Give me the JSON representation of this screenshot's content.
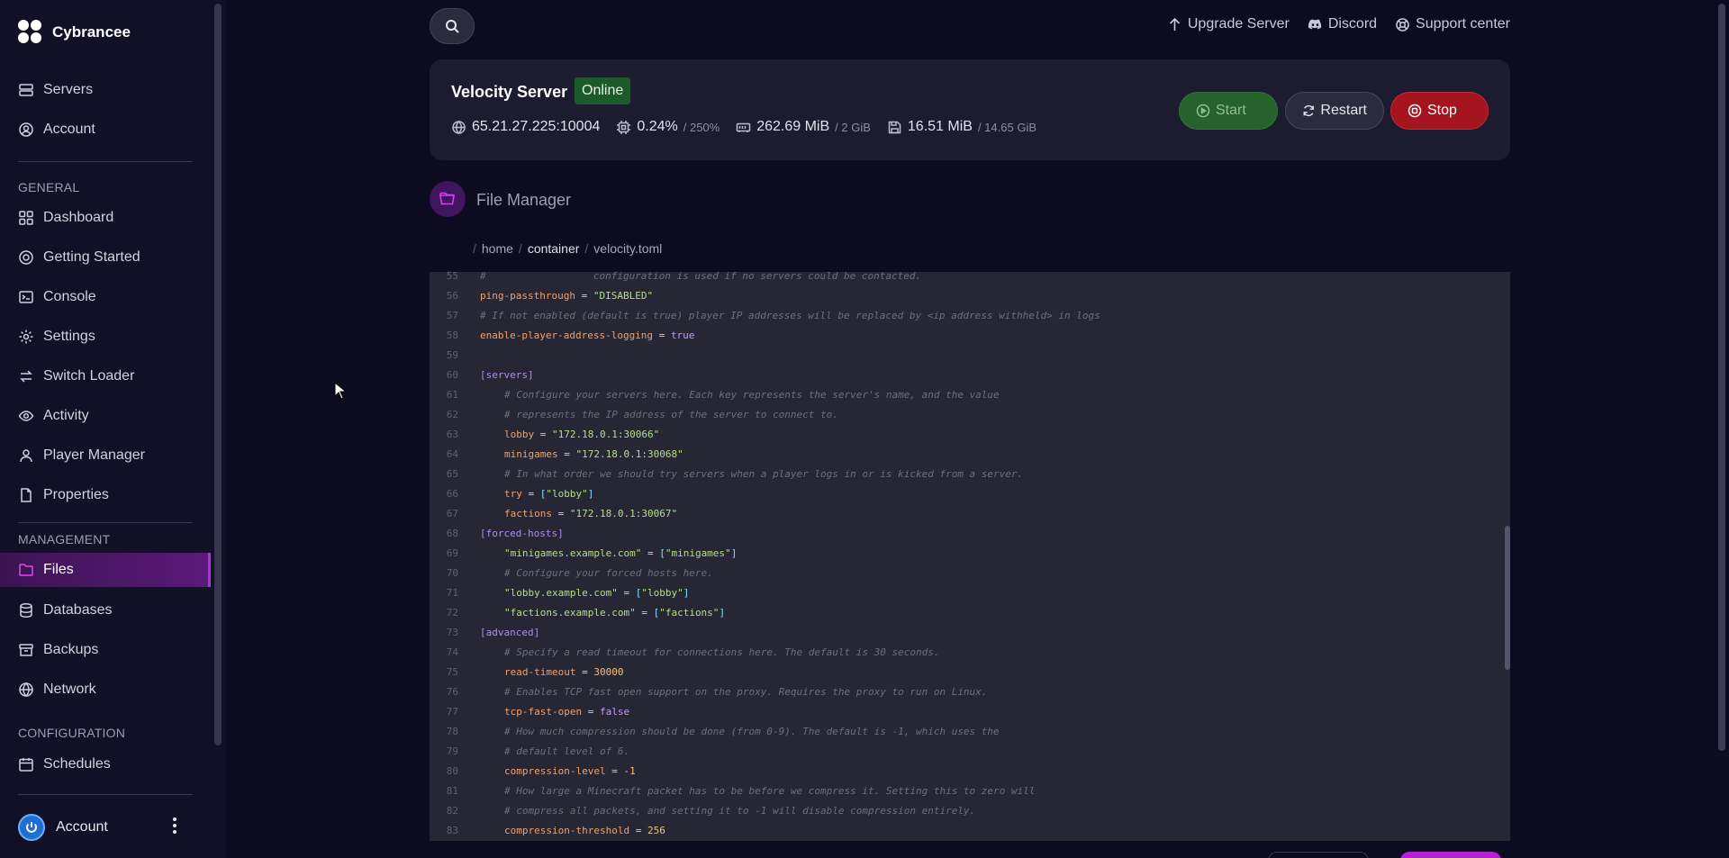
{
  "brand": {
    "name": "Cybrancee"
  },
  "sidebar": {
    "top_items": [
      {
        "label": "Servers"
      },
      {
        "label": "Account"
      }
    ],
    "sections": [
      {
        "title": "GENERAL"
      },
      {
        "title": "MANAGEMENT"
      },
      {
        "title": "CONFIGURATION"
      }
    ],
    "general": [
      {
        "label": "Dashboard"
      },
      {
        "label": "Getting Started"
      },
      {
        "label": "Console"
      },
      {
        "label": "Settings"
      },
      {
        "label": "Switch Loader"
      },
      {
        "label": "Activity"
      },
      {
        "label": "Player Manager"
      },
      {
        "label": "Properties"
      }
    ],
    "management": [
      {
        "label": "Files"
      },
      {
        "label": "Databases"
      },
      {
        "label": "Backups"
      },
      {
        "label": "Network"
      }
    ],
    "configuration": [
      {
        "label": "Schedules"
      }
    ],
    "account_label": "Account"
  },
  "topbar": {
    "links": [
      {
        "label": "Upgrade Server",
        "icon": "arrow-up-icon"
      },
      {
        "label": "Discord",
        "icon": "discord-icon"
      },
      {
        "label": "Support center",
        "icon": "lifebuoy-icon"
      }
    ]
  },
  "server": {
    "name": "Velocity Server",
    "status": "Online",
    "address": "65.21.27.225:10004",
    "cpu": "0.24%",
    "cpu_limit": "/ 250%",
    "memory": "262.69 MiB",
    "memory_limit": "/ 2 GiB",
    "disk": "16.51 MiB",
    "disk_limit": "/ 14.65 GiB",
    "buttons": {
      "start": "Start",
      "restart": "Restart",
      "stop": "Stop"
    },
    "colors": {
      "online": "#1d5a2a",
      "start": "#27612c",
      "stop": "#a4151f"
    }
  },
  "file_manager": {
    "title": "File Manager",
    "breadcrumb": {
      "root": "home",
      "folder": "container",
      "file": "velocity.toml"
    }
  },
  "editor": {
    "lines": [
      {
        "n": "55",
        "indent": 0,
        "tokens": [
          [
            "c-comment",
            "#                  configuration is used if no servers could be contacted."
          ]
        ]
      },
      {
        "n": "56",
        "indent": 0,
        "tokens": [
          [
            "c-key",
            "ping-passthrough"
          ],
          [
            "",
            " = "
          ],
          [
            "c-str",
            "\"DISABLED\""
          ]
        ]
      },
      {
        "n": "57",
        "indent": 0,
        "tokens": [
          [
            "c-comment",
            "# If not enabled (default is true) player IP addresses will be replaced by <ip address withheld> in logs"
          ]
        ]
      },
      {
        "n": "58",
        "indent": 0,
        "tokens": [
          [
            "c-key",
            "enable-player-address-logging"
          ],
          [
            "",
            " = "
          ],
          [
            "c-bool",
            "true"
          ]
        ]
      },
      {
        "n": "59",
        "indent": 0,
        "tokens": []
      },
      {
        "n": "60",
        "indent": 0,
        "tokens": [
          [
            "c-sec",
            "[servers]"
          ]
        ]
      },
      {
        "n": "61",
        "indent": 1,
        "tokens": [
          [
            "c-comment",
            "# Configure your servers here. Each key represents the server's name, and the value"
          ]
        ]
      },
      {
        "n": "62",
        "indent": 1,
        "tokens": [
          [
            "c-comment",
            "# represents the IP address of the server to connect to."
          ]
        ]
      },
      {
        "n": "63",
        "indent": 1,
        "tokens": [
          [
            "c-key",
            "lobby"
          ],
          [
            "",
            " = "
          ],
          [
            "c-str",
            "\"172.18.0.1:30066\""
          ]
        ]
      },
      {
        "n": "64",
        "indent": 1,
        "tokens": [
          [
            "c-key",
            "minigames"
          ],
          [
            "",
            " = "
          ],
          [
            "c-str",
            "\"172.18.0.1:30068\""
          ]
        ]
      },
      {
        "n": "65",
        "indent": 1,
        "tokens": [
          [
            "c-comment",
            "# In what order we should try servers when a player logs in or is kicked from a server."
          ]
        ]
      },
      {
        "n": "66",
        "indent": 1,
        "tokens": [
          [
            "c-key",
            "try"
          ],
          [
            "",
            " = "
          ],
          [
            "c-punct",
            "["
          ],
          [
            "c-str",
            "\"lobby\""
          ],
          [
            "c-punct",
            "]"
          ]
        ]
      },
      {
        "n": "67",
        "indent": 1,
        "tokens": [
          [
            "c-key",
            "factions"
          ],
          [
            "",
            " = "
          ],
          [
            "c-str",
            "\"172.18.0.1:30067\""
          ]
        ]
      },
      {
        "n": "68",
        "indent": 0,
        "tokens": [
          [
            "c-sec",
            "[forced-hosts]"
          ]
        ]
      },
      {
        "n": "69",
        "indent": 1,
        "tokens": [
          [
            "c-str",
            "\"minigames.example.com\""
          ],
          [
            "",
            " = "
          ],
          [
            "c-punct",
            "["
          ],
          [
            "c-str",
            "\"minigames\""
          ],
          [
            "c-punct",
            "]"
          ]
        ]
      },
      {
        "n": "70",
        "indent": 1,
        "tokens": [
          [
            "c-comment",
            "# Configure your forced hosts here."
          ]
        ]
      },
      {
        "n": "71",
        "indent": 1,
        "tokens": [
          [
            "c-str",
            "\"lobby.example.com\""
          ],
          [
            "",
            " = "
          ],
          [
            "c-punct",
            "["
          ],
          [
            "c-str",
            "\"lobby\""
          ],
          [
            "c-punct",
            "]"
          ]
        ]
      },
      {
        "n": "72",
        "indent": 1,
        "tokens": [
          [
            "c-str",
            "\"factions.example.com\""
          ],
          [
            "",
            " = "
          ],
          [
            "c-punct",
            "["
          ],
          [
            "c-str",
            "\"factions\""
          ],
          [
            "c-punct",
            "]"
          ]
        ]
      },
      {
        "n": "73",
        "indent": 0,
        "tokens": [
          [
            "c-sec",
            "[advanced]"
          ]
        ]
      },
      {
        "n": "74",
        "indent": 1,
        "tokens": [
          [
            "c-comment",
            "# Specify a read timeout for connections here. The default is 30 seconds."
          ]
        ]
      },
      {
        "n": "75",
        "indent": 1,
        "tokens": [
          [
            "c-key",
            "read-timeout"
          ],
          [
            "",
            " = "
          ],
          [
            "c-num",
            "30000"
          ]
        ]
      },
      {
        "n": "76",
        "indent": 1,
        "tokens": [
          [
            "c-comment",
            "# Enables TCP fast open support on the proxy. Requires the proxy to run on Linux."
          ]
        ]
      },
      {
        "n": "77",
        "indent": 1,
        "tokens": [
          [
            "c-key",
            "tcp-fast-open"
          ],
          [
            "",
            " = "
          ],
          [
            "c-bool",
            "false"
          ]
        ]
      },
      {
        "n": "78",
        "indent": 1,
        "tokens": [
          [
            "c-comment",
            "# How much compression should be done (from 0-9). The default is -1, which uses the"
          ]
        ]
      },
      {
        "n": "79",
        "indent": 1,
        "tokens": [
          [
            "c-comment",
            "# default level of 6."
          ]
        ]
      },
      {
        "n": "80",
        "indent": 1,
        "tokens": [
          [
            "c-key",
            "compression-level"
          ],
          [
            "",
            " = "
          ],
          [
            "c-num",
            "-1"
          ]
        ]
      },
      {
        "n": "81",
        "indent": 1,
        "tokens": [
          [
            "c-comment",
            "# How large a Minecraft packet has to be before we compress it. Setting this to zero will"
          ]
        ]
      },
      {
        "n": "82",
        "indent": 1,
        "tokens": [
          [
            "c-comment",
            "# compress all packets, and setting it to -1 will disable compression entirely."
          ]
        ]
      },
      {
        "n": "83",
        "indent": 1,
        "tokens": [
          [
            "c-key",
            "compression-threshold"
          ],
          [
            "",
            " = "
          ],
          [
            "c-num",
            "256"
          ]
        ]
      }
    ]
  }
}
